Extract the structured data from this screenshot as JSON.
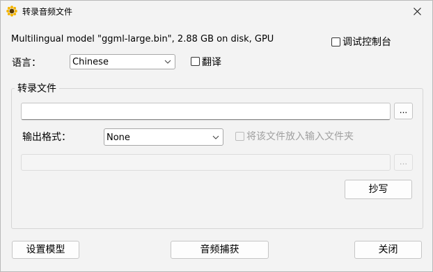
{
  "window": {
    "title": "转录音频文件"
  },
  "model_info": "Multilingual model \"ggml-large.bin\", 2.88 GB on disk, GPU",
  "debug_console": {
    "label": "调试控制台",
    "checked": false
  },
  "language": {
    "label": "语言：",
    "value": "Chinese"
  },
  "translate": {
    "label": "翻译",
    "checked": false
  },
  "transcribe_group": {
    "title": "转录文件",
    "input_file": {
      "value": "",
      "browse_label": "..."
    },
    "output_format": {
      "label": "输出格式：",
      "value": "None"
    },
    "place_in_input_folder": {
      "label": "将该文件放入输入文件夹",
      "checked": false,
      "enabled": false
    },
    "output_file": {
      "value": "",
      "browse_label": "..."
    },
    "transcribe_button": "抄写"
  },
  "footer": {
    "setup_model": "设置模型",
    "audio_capture": "音频捕获",
    "close": "关闭"
  },
  "colors": {
    "icon_yellow": "#f4b400",
    "icon_dark": "#5a3a00"
  }
}
